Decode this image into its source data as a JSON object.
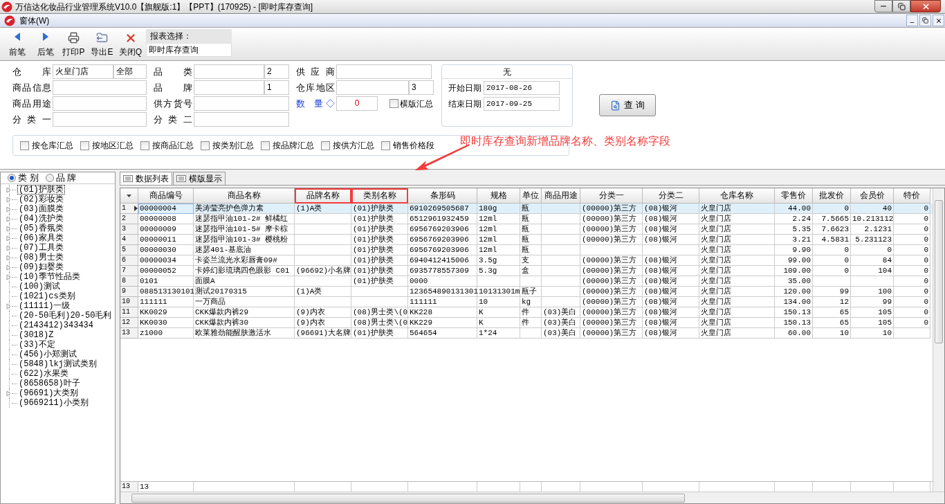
{
  "window": {
    "title": "万信达化妆品行业管理系统V10.0【旗舰版:1】【PPT】(170925) - [即时库存查询]"
  },
  "menu": {
    "items": [
      "窗体(W)"
    ]
  },
  "toolbar": {
    "buttons": [
      {
        "kind": "prev",
        "label": "前笔"
      },
      {
        "kind": "next",
        "label": "后笔"
      },
      {
        "kind": "print",
        "label": "打印P"
      },
      {
        "kind": "export",
        "label": "导出E"
      },
      {
        "kind": "close",
        "label": "关闭Q"
      }
    ],
    "report_label": "报表选择：",
    "report_value": "即时库存查询"
  },
  "filters": {
    "columns": [
      [
        {
          "label": "仓 库",
          "value": "火皇门店",
          "extra": "全部"
        },
        {
          "label": "商品信息"
        },
        {
          "label": "商品用途"
        },
        {
          "label": "分 类 一"
        }
      ],
      [
        {
          "label": "品 类",
          "extra": "2"
        },
        {
          "label": "品 牌",
          "extra": "1"
        },
        {
          "label": "供方货号"
        },
        {
          "label": "分 类 二"
        }
      ],
      [
        {
          "label": "供 应 商"
        },
        {
          "label": "仓库地区",
          "extra": "3"
        }
      ]
    ],
    "quantity": {
      "label": "数 量◇",
      "value": "0"
    },
    "horizontal_summary": {
      "label": "横版汇总",
      "checked": false
    },
    "date_box": {
      "header": "无",
      "start_label": "开始日期",
      "start": "2017-08-26",
      "end_label": "结束日期",
      "end": "2017-09-25"
    },
    "query_button": "查 询",
    "summaries": [
      {
        "label": "按仓库汇总",
        "checked": false
      },
      {
        "label": "按地区汇总",
        "checked": false
      },
      {
        "label": "按商品汇总",
        "checked": false
      },
      {
        "label": "按类别汇总",
        "checked": false
      },
      {
        "label": "按品牌汇总",
        "checked": false
      },
      {
        "label": "按供方汇总",
        "checked": false
      },
      {
        "label": "销售价格段",
        "checked": false
      }
    ]
  },
  "annotation": {
    "text": "即时库存查询新增品牌名称、类别名称字段"
  },
  "sidebar": {
    "radios": [
      {
        "label": "类 别",
        "selected": true
      },
      {
        "label": "品 牌",
        "selected": false
      }
    ],
    "tree": [
      {
        "label": "(01)护肤类",
        "kind": "folder",
        "selected": true
      },
      {
        "label": "(02)彩妆类",
        "kind": "folder",
        "selected": false
      },
      {
        "label": "(03)面膜类",
        "kind": "folder",
        "selected": false
      },
      {
        "label": "(04)洗护类",
        "kind": "folder",
        "selected": false
      },
      {
        "label": "(05)香氛类",
        "kind": "folder",
        "selected": false
      },
      {
        "label": "(06)家具类",
        "kind": "folder",
        "selected": false
      },
      {
        "label": "(07)工具类",
        "kind": "folder",
        "selected": false
      },
      {
        "label": "(08)男士类",
        "kind": "folder",
        "selected": false
      },
      {
        "label": "(09)妇婴类",
        "kind": "folder",
        "selected": false
      },
      {
        "label": "(10)季节性品类",
        "kind": "folder",
        "selected": false
      },
      {
        "label": "(100)测试",
        "kind": "leaf",
        "selected": false
      },
      {
        "label": "(1021)cs类别",
        "kind": "leaf",
        "selected": false
      },
      {
        "label": "(11111)一级",
        "kind": "folder",
        "selected": false
      },
      {
        "label": "(20-50毛利)20-50毛利",
        "kind": "leaf",
        "selected": false
      },
      {
        "label": "(2143412)343434",
        "kind": "leaf",
        "selected": false
      },
      {
        "label": "(3018)Z",
        "kind": "leaf",
        "selected": false
      },
      {
        "label": "(33)不定",
        "kind": "leaf",
        "selected": false
      },
      {
        "label": "(456)小郑测试",
        "kind": "leaf",
        "selected": false
      },
      {
        "label": "(5848)lkj测试类别",
        "kind": "leaf",
        "selected": false
      },
      {
        "label": "(622)水果类",
        "kind": "leaf",
        "selected": false
      },
      {
        "label": "(8658658)叶子",
        "kind": "leaf",
        "selected": false
      },
      {
        "label": "(96691)大类别",
        "kind": "folder",
        "selected": false
      },
      {
        "label": "(9669211)小类别",
        "kind": "leaf",
        "selected": false
      }
    ]
  },
  "tabs": [
    {
      "label": "数据列表",
      "selected": true
    },
    {
      "label": "横版显示",
      "selected": false
    }
  ],
  "table": {
    "columns": [
      {
        "label": "商品编号",
        "highlighted": false
      },
      {
        "label": "商品名称",
        "highlighted": false
      },
      {
        "label": "品牌名称",
        "highlighted": true
      },
      {
        "label": "类别名称",
        "highlighted": true
      },
      {
        "label": "条形码",
        "highlighted": false
      },
      {
        "label": "规格",
        "highlighted": false
      },
      {
        "label": "单位",
        "highlighted": false
      },
      {
        "label": "商品用途",
        "highlighted": false
      },
      {
        "label": "分类一",
        "highlighted": false
      },
      {
        "label": "分类二",
        "highlighted": false
      },
      {
        "label": "仓库名称",
        "highlighted": false
      },
      {
        "label": "零售价",
        "highlighted": false
      },
      {
        "label": "批发价",
        "highlighted": false
      },
      {
        "label": "会员价",
        "highlighted": false
      },
      {
        "label": "特价",
        "highlighted": false
      }
    ],
    "rows": [
      {
        "number": "1",
        "selected": true,
        "cells": [
          "00000004",
          "美涛莹亮护色弹力素",
          "(1)A类",
          "(01)护肤类",
          "6910269505687",
          "180g",
          "瓶",
          "",
          "(00000)第三方",
          "(08)银河",
          "火皇门店",
          "44.00",
          "0",
          "40",
          "0"
        ]
      },
      {
        "number": "2",
        "selected": false,
        "cells": [
          "00000008",
          "迷瑟指甲油101-2# 鲜橘红",
          "",
          "(01)护肤类",
          "6512961932459",
          "12ml",
          "瓶",
          "",
          "(00000)第三方",
          "(08)银河",
          "火皇门店",
          "2.24",
          "7.5665",
          "10.213112",
          "0"
        ]
      },
      {
        "number": "3",
        "selected": false,
        "cells": [
          "00000009",
          "迷瑟指甲油101-5# 摩卡棕",
          "",
          "(01)护肤类",
          "6956769203906",
          "12ml",
          "瓶",
          "",
          "(00000)第三方",
          "(08)银河",
          "火皇门店",
          "5.35",
          "7.6623",
          "2.1231",
          "0"
        ]
      },
      {
        "number": "4",
        "selected": false,
        "cells": [
          "00000011",
          "迷瑟指甲油101-3# 樱桃粉",
          "",
          "(01)护肤类",
          "6956769203906",
          "12ml",
          "瓶",
          "",
          "(00000)第三方",
          "(08)银河",
          "火皇门店",
          "3.21",
          "4.5831",
          "5.231123",
          "0"
        ]
      },
      {
        "number": "5",
        "selected": false,
        "cells": [
          "00000030",
          "迷瑟401-基底油",
          "",
          "(01)护肤类",
          "6956769203906",
          "12ml",
          "瓶",
          "",
          "",
          "",
          "火皇门店",
          "9.90",
          "0",
          "0",
          "0"
        ]
      },
      {
        "number": "6",
        "selected": false,
        "cells": [
          "00000034",
          "卡姿兰流光水彩唇膏09#",
          "",
          "(01)护肤类",
          "6940412415006",
          "3.5g",
          "支",
          "",
          "(00000)第三方",
          "(08)银河",
          "火皇门店",
          "99.00",
          "0",
          "84",
          "0"
        ]
      },
      {
        "number": "7",
        "selected": false,
        "cells": [
          "00000052",
          "卡婷幻影琉璃四色眼影 C01",
          "(96692)小名牌",
          "(01)护肤类",
          "6935778557309",
          "5.3g",
          "盒",
          "",
          "(00000)第三方",
          "(08)银河",
          "火皇门店",
          "109.00",
          "0",
          "104",
          "0"
        ]
      },
      {
        "number": "8",
        "selected": false,
        "cells": [
          "0101",
          "面膜A",
          "",
          "(01)护肤类",
          "0000",
          "",
          "",
          "",
          "(00000)第三方",
          "(08)银河",
          "火皇门店",
          "35.00",
          "",
          "",
          "0"
        ]
      },
      {
        "number": "9",
        "selected": false,
        "cells": [
          "088513130101",
          "测试20170315",
          "(1)A类",
          "",
          "123654890131301",
          "10131301m",
          "瓶子",
          "",
          "(00000)第三方",
          "(08)银河",
          "火皇门店",
          "120.00",
          "99",
          "100",
          "0"
        ]
      },
      {
        "number": "10",
        "selected": false,
        "cells": [
          "111111",
          "一万商品",
          "",
          "",
          "111111",
          "10",
          "kg",
          "",
          "(00000)第三方",
          "(08)银河",
          "火皇门店",
          "134.00",
          "12",
          "99",
          "0"
        ]
      },
      {
        "number": "11",
        "selected": false,
        "cells": [
          "KK0029",
          "CKK爆款内裤29",
          "(9)内衣",
          "(08)男士类\\(0",
          "KK228",
          "K",
          "件",
          "(03)美白",
          "(00000)第三方",
          "(08)银河",
          "火皇门店",
          "150.13",
          "65",
          "105",
          "0"
        ]
      },
      {
        "number": "12",
        "selected": false,
        "cells": [
          "KK0030",
          "CKK爆款内裤30",
          "(9)内衣",
          "(08)男士类\\(0",
          "KK229",
          "K",
          "件",
          "(03)美白",
          "(00000)第三方",
          "(08)银河",
          "火皇门店",
          "150.13",
          "65",
          "105",
          "0"
        ]
      },
      {
        "number": "13",
        "selected": false,
        "cells": [
          "z1000",
          "欧莱雅劲能醒肤激活水",
          "(96691)大名牌",
          "(01)护肤类",
          "564654",
          "1*24",
          "",
          "(03)美白",
          "(00000)第三方",
          "(08)银河",
          "火皇门店",
          "60.00",
          "10",
          "10",
          ""
        ]
      }
    ],
    "footer": {
      "number": "13",
      "count": "13"
    }
  }
}
